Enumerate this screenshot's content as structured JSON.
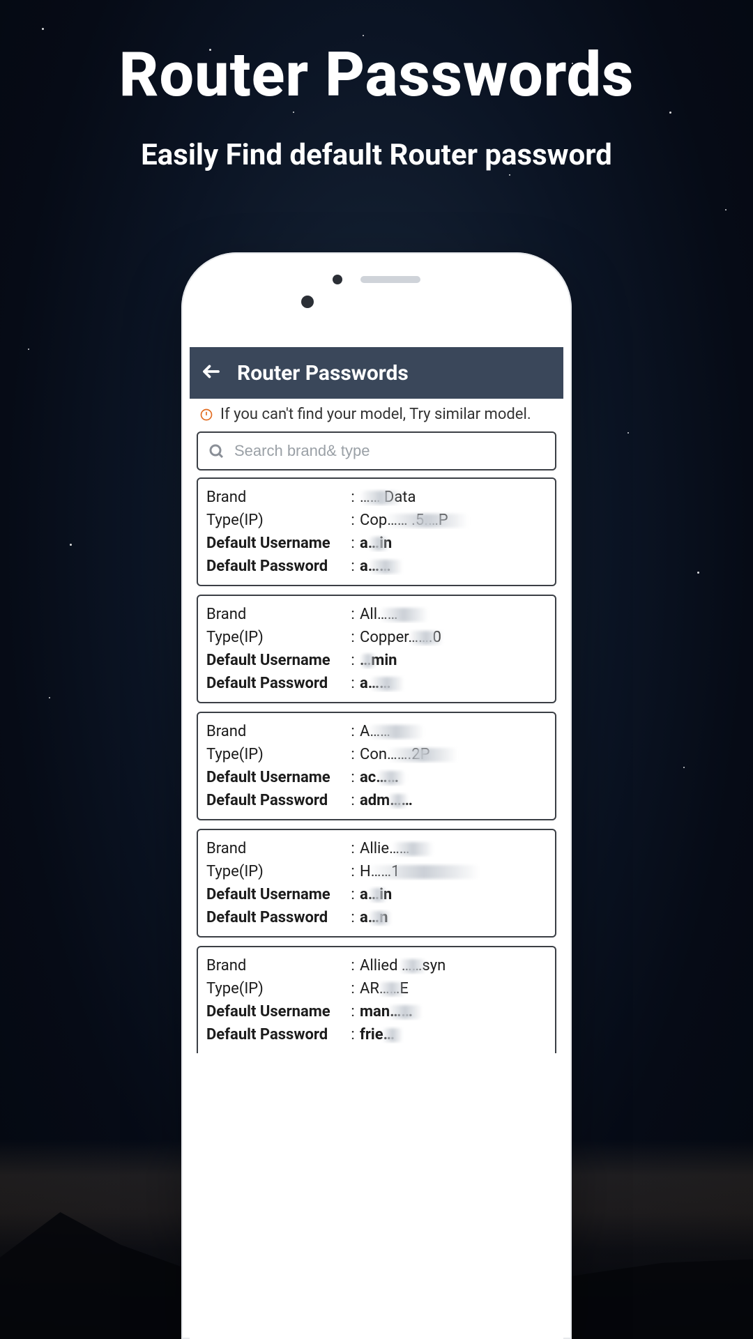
{
  "promo": {
    "title": "Router Passwords",
    "subtitle": "Easily Find default Router password"
  },
  "appbar": {
    "title": "Router Passwords"
  },
  "notice": "If you can't find your model, Try similar model.",
  "search": {
    "placeholder": "Search brand& type",
    "value": ""
  },
  "labels": {
    "brand": "Brand",
    "type": "Type(IP)",
    "username": "Default Username",
    "password": "Default Password",
    "colon": ":"
  },
  "items": [
    {
      "brand_visible": "…… Data",
      "type_visible": "Cop…… .5.…P",
      "username_visible": "a…in",
      "password_visible": "a……"
    },
    {
      "brand_visible": "All……",
      "type_visible": "Copper…….0",
      "username_visible": "…min",
      "password_visible": "a……"
    },
    {
      "brand_visible": "A……",
      "type_visible": "Con…….2P",
      "username_visible": "ac……",
      "password_visible": "adm……"
    },
    {
      "brand_visible": "Allie……",
      "type_visible": "H……1",
      "username_visible": "a…in",
      "password_visible": "a…n"
    },
    {
      "brand_visible": "Allied ……syn",
      "type_visible": "AR……E",
      "username_visible": "man……",
      "password_visible": "frie…"
    }
  ],
  "colors": {
    "appbar_bg": "#3a475a",
    "accent": "#e26b1f",
    "border": "#3b3f45"
  }
}
